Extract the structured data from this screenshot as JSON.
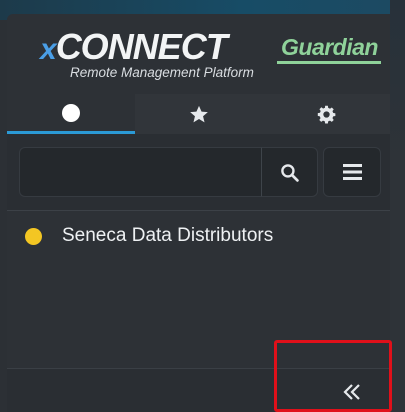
{
  "logo": {
    "brand_prefix": "x",
    "brand_main": "CONNECT",
    "product": "Guardian",
    "subtitle": "Remote Management Platform"
  },
  "tabs": [
    {
      "icon": "circle-icon",
      "active": true
    },
    {
      "icon": "star-icon",
      "active": false
    },
    {
      "icon": "gear-icon",
      "active": false
    }
  ],
  "search": {
    "value": "",
    "placeholder": ""
  },
  "list": {
    "items": [
      {
        "label": "Seneca Data Distributors",
        "status_color": "#f3c623"
      }
    ]
  },
  "footer": {
    "collapse_icon": "double-chevron-left-icon"
  },
  "colors": {
    "accent": "#2b9ad6",
    "logo_blue": "#4a9ee6",
    "logo_green": "#8fd29a",
    "highlight_box": "#e0101a"
  }
}
